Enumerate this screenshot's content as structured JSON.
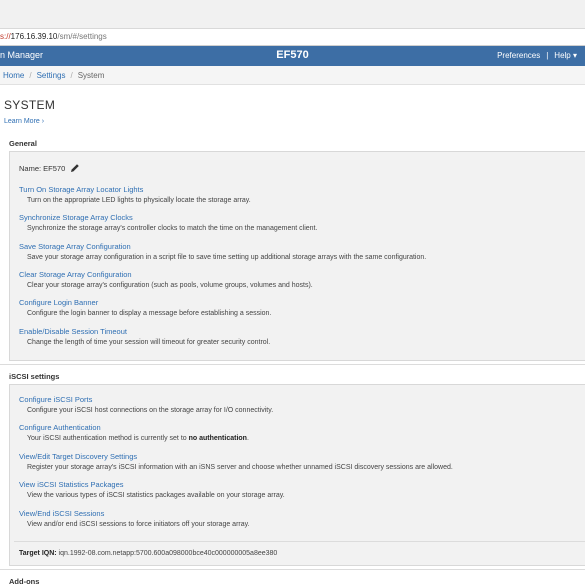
{
  "browser": {
    "url_proto": "s://",
    "url_host": "176.16.39.10",
    "url_path": "/sm/#/settings"
  },
  "appbar": {
    "brand": "n Manager",
    "array_name": "EF570",
    "preferences": "Preferences",
    "separator": "|",
    "help": "Help",
    "help_caret": "▾"
  },
  "breadcrumb": {
    "items": [
      "Home",
      "Settings",
      "System"
    ],
    "slash": "/"
  },
  "page": {
    "title": "SYSTEM",
    "learn_more": "Learn More ›"
  },
  "general": {
    "heading": "General",
    "name_label": "Name: EF570",
    "items": [
      {
        "link": "Turn On Storage Array Locator Lights",
        "desc": "Turn on the appropriate LED lights to physically locate the storage array."
      },
      {
        "link": "Synchronize Storage Array Clocks",
        "desc": "Synchronize the storage array's controller clocks to match the time on the management client."
      },
      {
        "link": "Save Storage Array Configuration",
        "desc": "Save your storage array configuration in a script file to save time setting up additional storage arrays with the same configuration."
      },
      {
        "link": "Clear Storage Array Configuration",
        "desc": "Clear your storage array's configuration (such as pools, volume groups, volumes and hosts)."
      },
      {
        "link": "Configure Login Banner",
        "desc": "Configure the login banner to display a message before establishing a session."
      },
      {
        "link": "Enable/Disable Session Timeout",
        "desc": "Change the length of time your session will timeout for greater security control."
      }
    ]
  },
  "iscsi": {
    "heading": "iSCSI settings",
    "items": [
      {
        "link": "Configure iSCSI Ports",
        "desc": "Configure your iSCSI host connections on the storage array for I/O connectivity."
      },
      {
        "link": "Configure Authentication",
        "desc": "Your iSCSI authentication method is currently set to ",
        "desc_bold": "no authentication",
        "desc_end": "."
      },
      {
        "link": "View/Edit Target Discovery Settings",
        "desc": "Register your storage array's iSCSI information with an iSNS server and choose whether unnamed iSCSI discovery sessions are allowed."
      },
      {
        "link": "View iSCSI Statistics Packages",
        "desc": "View the various types of iSCSI statistics packages available on your storage array."
      },
      {
        "link": "View/End iSCSI Sessions",
        "desc": "View and/or end iSCSI sessions to force initiators off your storage array."
      }
    ],
    "iqn_label": "Target IQN:",
    "iqn_value": " iqn.1992-08.com.netapp:5700.600a098000bce40c000000005a8ee380"
  },
  "next_section": {
    "heading": "Add-ons"
  }
}
